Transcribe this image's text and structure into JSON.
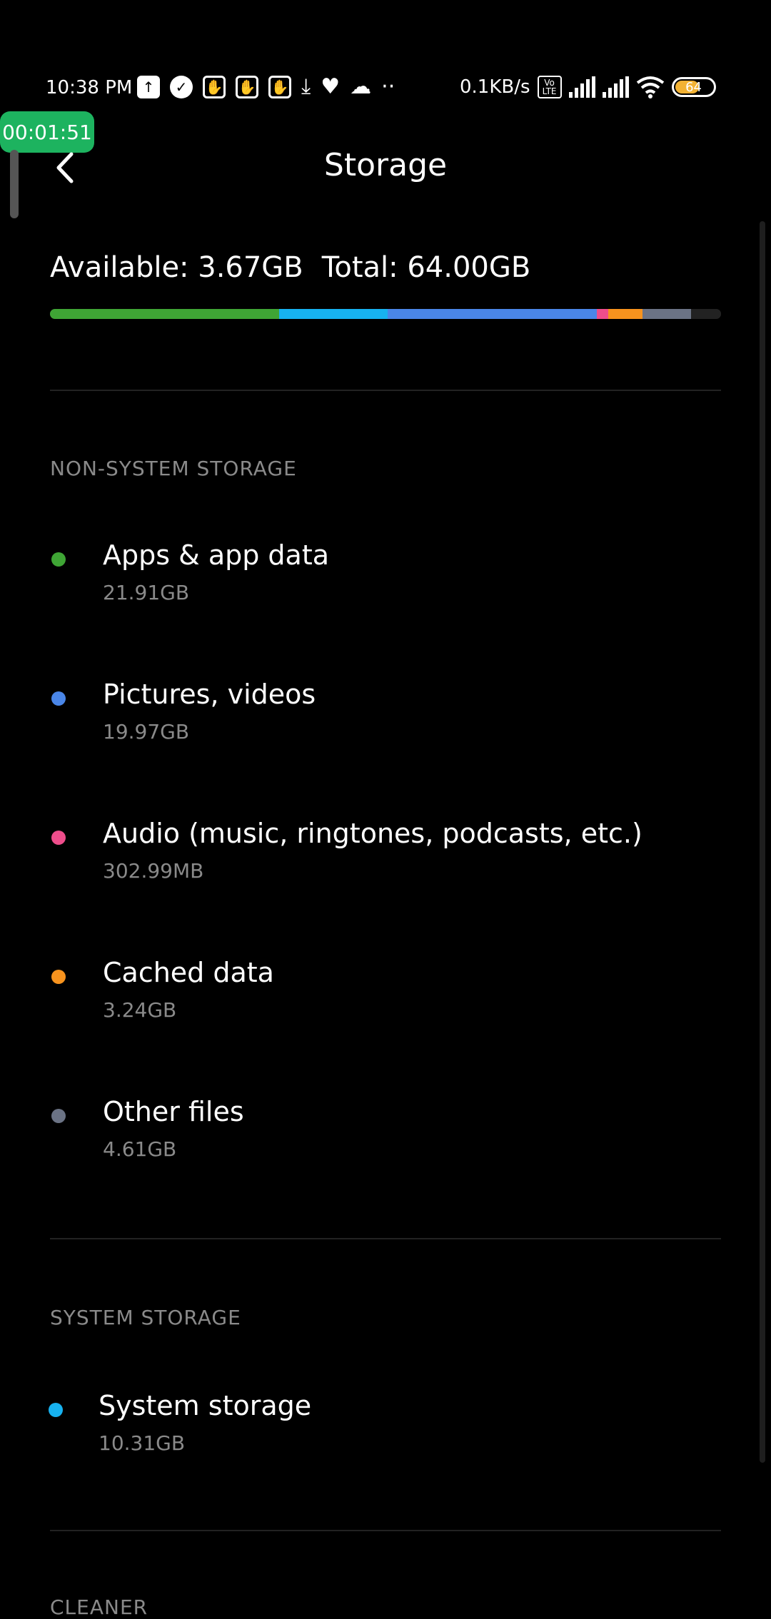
{
  "status_bar": {
    "time": "10:38 PM",
    "net_speed": "0.1KB/s",
    "battery": "64",
    "volte_top": "Vo",
    "volte_bottom": "LTE",
    "icons": [
      "upload-icon",
      "check-icon",
      "hand-icon",
      "hand-icon",
      "hand-icon",
      "download-icon",
      "heart-icon",
      "cloud-icon",
      "more-dots-icon"
    ]
  },
  "recorder": {
    "timer": "00:01:51"
  },
  "header": {
    "title": "Storage"
  },
  "summary": {
    "available": "Available: 3.67GB",
    "total": "Total: 64.00GB"
  },
  "usage_bar": [
    {
      "label": "Apps & app data",
      "fraction": 0.342,
      "color": "#3fa535"
    },
    {
      "label": "System storage",
      "fraction": 0.161,
      "color": "#17b2f0"
    },
    {
      "label": "Pictures, videos",
      "fraction": 0.312,
      "color": "#4a86e8"
    },
    {
      "label": "Audio",
      "fraction": 0.017,
      "color": "#ee4d8b"
    },
    {
      "label": "Cached data",
      "fraction": 0.051,
      "color": "#f7931e"
    },
    {
      "label": "Other files",
      "fraction": 0.072,
      "color": "#6b7385"
    },
    {
      "label": "Available",
      "fraction": 0.045,
      "color": "#222222"
    }
  ],
  "non_system": {
    "label": "NON-SYSTEM STORAGE",
    "items": [
      {
        "name": "Apps & app data",
        "size": "21.91GB",
        "color": "#3fa535"
      },
      {
        "name": "Pictures, videos",
        "size": "19.97GB",
        "color": "#4a86e8"
      },
      {
        "name": "Audio (music, ringtones, podcasts, etc.)",
        "size": "302.99MB",
        "color": "#ee4d8b"
      },
      {
        "name": "Cached data",
        "size": "3.24GB",
        "color": "#f7931e"
      },
      {
        "name": "Other files",
        "size": "4.61GB",
        "color": "#6b7385"
      }
    ]
  },
  "system": {
    "label": "SYSTEM STORAGE",
    "items": [
      {
        "name": "System storage",
        "size": "10.31GB",
        "color": "#17b2f0"
      }
    ]
  },
  "cleaner": {
    "label": "CLEANER"
  }
}
